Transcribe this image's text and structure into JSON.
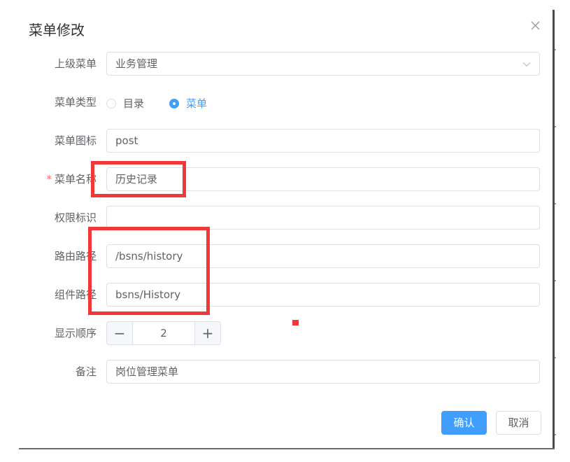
{
  "dialog": {
    "title": "菜单修改",
    "close_icon": "close-icon"
  },
  "form": {
    "parent_menu": {
      "label": "上级菜单",
      "value": "业务管理",
      "arrow_icon": "chevron-down-icon"
    },
    "menu_type": {
      "label": "菜单类型",
      "options": [
        {
          "label": "目录",
          "checked": false
        },
        {
          "label": "菜单",
          "checked": true
        }
      ]
    },
    "menu_icon": {
      "label": "菜单图标",
      "value": "post"
    },
    "menu_name": {
      "label": "菜单名称",
      "required_mark": "*",
      "value": "历史记录"
    },
    "permission": {
      "label": "权限标识",
      "value": ""
    },
    "route_path": {
      "label": "路由路径",
      "value": "/bsns/history"
    },
    "component_path": {
      "label": "组件路径",
      "value": "bsns/History"
    },
    "display_order": {
      "label": "显示顺序",
      "value": "2",
      "minus": "−",
      "plus": "+"
    },
    "remark": {
      "label": "备注",
      "value": "岗位管理菜单"
    }
  },
  "footer": {
    "confirm_label": "确认",
    "cancel_label": "取消"
  },
  "colors": {
    "primary": "#409eff",
    "annotation": "#f03838",
    "required": "#f56c6c"
  }
}
